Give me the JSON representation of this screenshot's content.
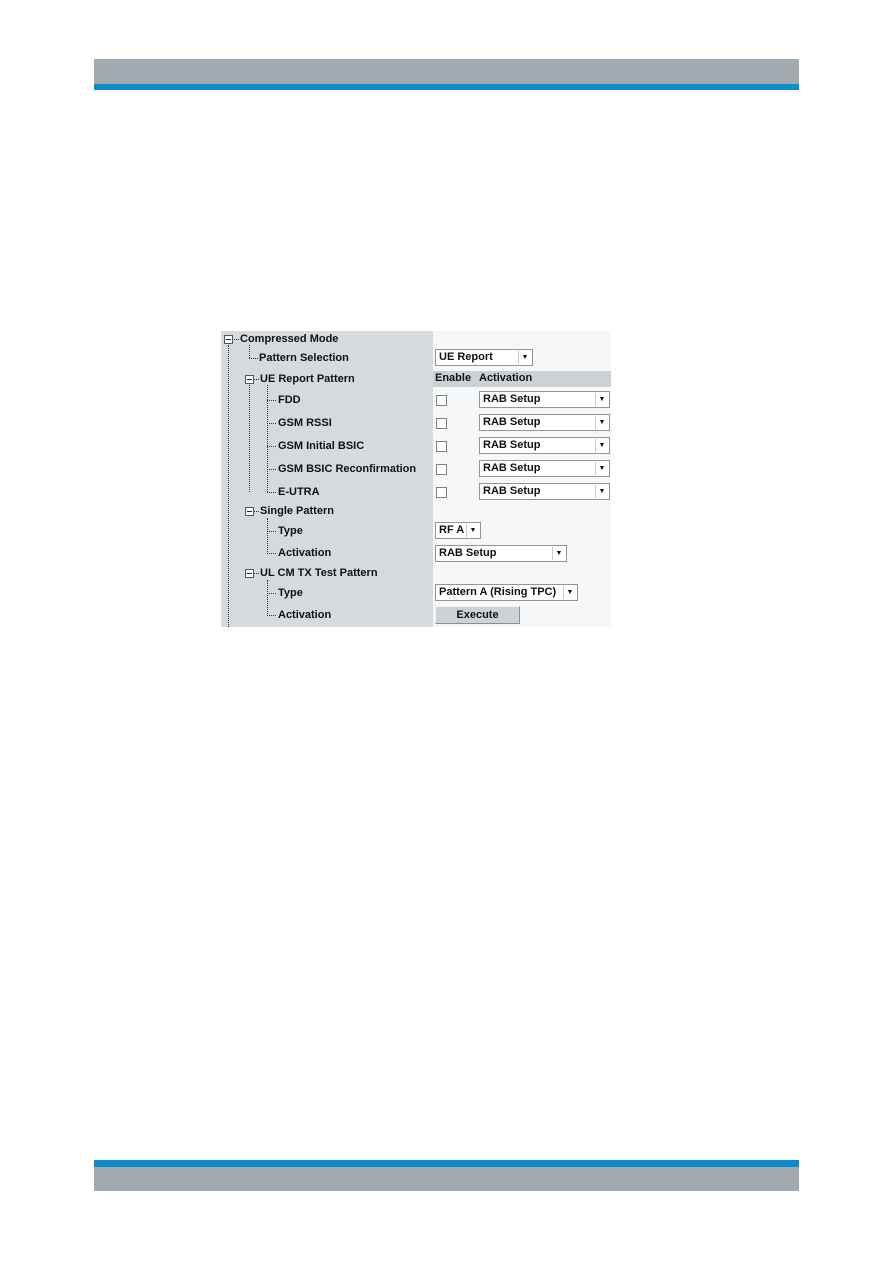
{
  "colors": {
    "header_gray": "#a2aaaf",
    "accent_blue": "#0a8ccf",
    "tree_bg": "#d6dadd"
  },
  "tree": {
    "root": "Compressed Mode",
    "pattern_selection": "Pattern Selection",
    "ue_report_pattern": "UE Report Pattern",
    "fdd": "FDD",
    "gsm_rssi": "GSM RSSI",
    "gsm_initial_bsic": "GSM Initial BSIC",
    "gsm_bsic_reconfirmation": "GSM BSIC Reconfirmation",
    "e_utra": "E-UTRA",
    "single_pattern": "Single Pattern",
    "single_type": "Type",
    "single_activation": "Activation",
    "ul_cm_tx_test_pattern": "UL CM TX Test Pattern",
    "ul_type": "Type",
    "ul_activation": "Activation"
  },
  "controls": {
    "pattern_selection_value": "UE Report",
    "col_enable": "Enable",
    "col_activation": "Activation",
    "ue_rows": [
      {
        "enabled": false,
        "activation": "RAB Setup"
      },
      {
        "enabled": false,
        "activation": "RAB Setup"
      },
      {
        "enabled": false,
        "activation": "RAB Setup"
      },
      {
        "enabled": false,
        "activation": "RAB Setup"
      },
      {
        "enabled": false,
        "activation": "RAB Setup"
      }
    ],
    "single_type_value": "RF A",
    "single_activation_value": "RAB Setup",
    "ul_type_value": "Pattern A (Rising TPC)",
    "execute_label": "Execute"
  }
}
